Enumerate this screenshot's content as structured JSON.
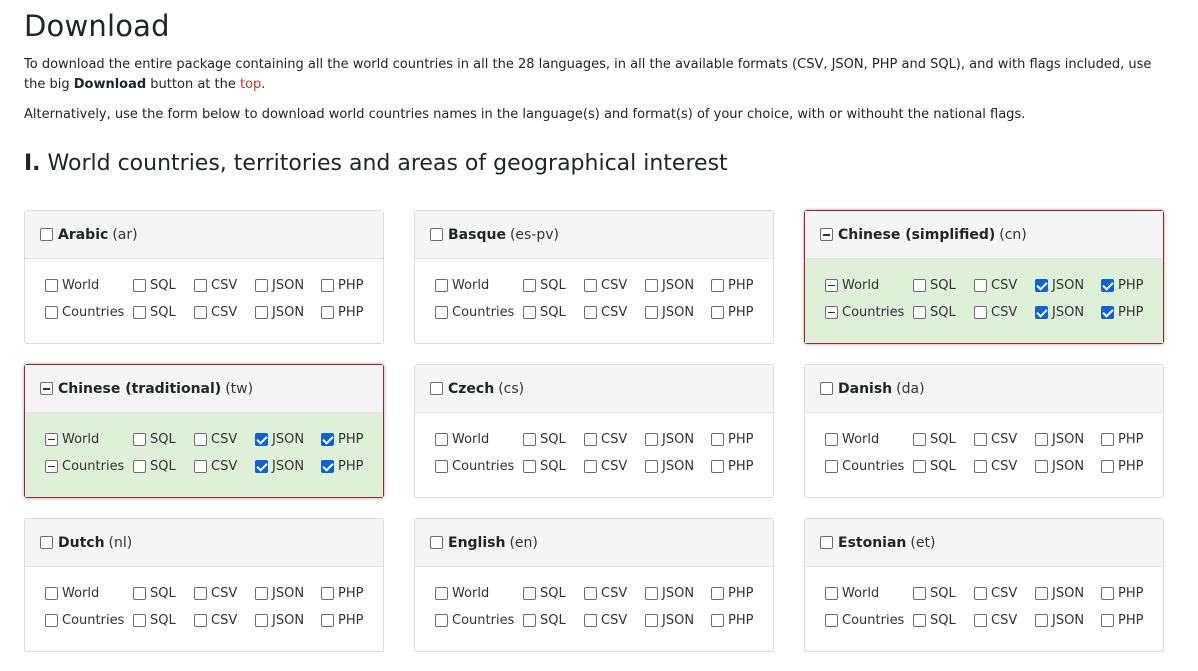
{
  "title": "Download",
  "intro": {
    "p1_before": "To download the entire package containing all the world countries in all the 28 languages, in all the available formats (CSV, JSON, PHP and SQL), and with flags included, use the big ",
    "p1_bold": "Download",
    "p1_middle": " button at the ",
    "p1_link": "top",
    "p1_after": ".",
    "p2": "Alternatively, use the form below to download world countries names in the language(s) and format(s) of your choice, with or withouht the national flags."
  },
  "section": {
    "number": "I.",
    "title": "World countries, territories and areas of geographical interest"
  },
  "row_labels": {
    "world": "World",
    "countries": "Countries"
  },
  "formats": [
    "SQL",
    "CSV",
    "JSON",
    "PHP"
  ],
  "colors": {
    "selected_bg": "#dff0d8",
    "selected_border": "#8b2b2b",
    "check_blue": "#0b63d6",
    "link": "#c0392b"
  },
  "languages": [
    {
      "name": "Arabic",
      "code": "(ar)",
      "state": "unchecked",
      "world": {
        "state": "unchecked",
        "formats": [
          false,
          false,
          false,
          false
        ]
      },
      "countries": {
        "state": "unchecked",
        "formats": [
          false,
          false,
          false,
          false
        ]
      }
    },
    {
      "name": "Basque",
      "code": "(es-pv)",
      "state": "unchecked",
      "world": {
        "state": "unchecked",
        "formats": [
          false,
          false,
          false,
          false
        ]
      },
      "countries": {
        "state": "unchecked",
        "formats": [
          false,
          false,
          false,
          false
        ]
      }
    },
    {
      "name": "Chinese (simplified)",
      "code": "(cn)",
      "state": "indeterminate",
      "world": {
        "state": "indeterminate",
        "formats": [
          false,
          false,
          true,
          true
        ]
      },
      "countries": {
        "state": "indeterminate",
        "formats": [
          false,
          false,
          true,
          true
        ]
      }
    },
    {
      "name": "Chinese (traditional)",
      "code": "(tw)",
      "state": "indeterminate",
      "world": {
        "state": "indeterminate",
        "formats": [
          false,
          false,
          true,
          true
        ]
      },
      "countries": {
        "state": "indeterminate",
        "formats": [
          false,
          false,
          true,
          true
        ]
      }
    },
    {
      "name": "Czech",
      "code": "(cs)",
      "state": "unchecked",
      "world": {
        "state": "unchecked",
        "formats": [
          false,
          false,
          false,
          false
        ]
      },
      "countries": {
        "state": "unchecked",
        "formats": [
          false,
          false,
          false,
          false
        ]
      }
    },
    {
      "name": "Danish",
      "code": "(da)",
      "state": "unchecked",
      "world": {
        "state": "unchecked",
        "formats": [
          false,
          false,
          false,
          false
        ]
      },
      "countries": {
        "state": "unchecked",
        "formats": [
          false,
          false,
          false,
          false
        ]
      }
    },
    {
      "name": "Dutch",
      "code": "(nl)",
      "state": "unchecked",
      "world": {
        "state": "unchecked",
        "formats": [
          false,
          false,
          false,
          false
        ]
      },
      "countries": {
        "state": "unchecked",
        "formats": [
          false,
          false,
          false,
          false
        ]
      }
    },
    {
      "name": "English",
      "code": "(en)",
      "state": "unchecked",
      "world": {
        "state": "unchecked",
        "formats": [
          false,
          false,
          false,
          false
        ]
      },
      "countries": {
        "state": "unchecked",
        "formats": [
          false,
          false,
          false,
          false
        ]
      }
    },
    {
      "name": "Estonian",
      "code": "(et)",
      "state": "unchecked",
      "world": {
        "state": "unchecked",
        "formats": [
          false,
          false,
          false,
          false
        ]
      },
      "countries": {
        "state": "unchecked",
        "formats": [
          false,
          false,
          false,
          false
        ]
      }
    }
  ]
}
